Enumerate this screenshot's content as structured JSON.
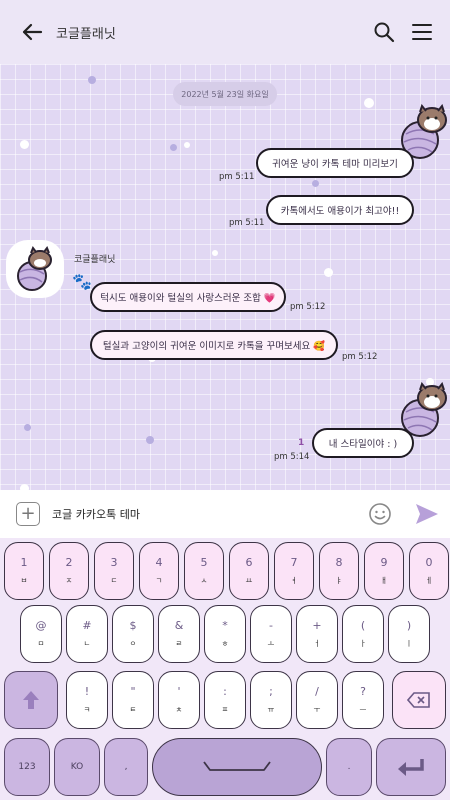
{
  "header": {
    "title": "코글플래닛"
  },
  "chat": {
    "date": "2022년 5월 23일 화요일",
    "sender_name": "코글플래닛",
    "messages": [
      {
        "text": "귀여운 냥이 카톡 테마 미리보기",
        "time": "pm 5:11",
        "side": "out"
      },
      {
        "text": "카톡에서도 애용이가 최고야!!",
        "time": "pm 5:11",
        "side": "out"
      },
      {
        "text": "턱시도 애용이와 털실의 사랑스러운 조합 💗",
        "time": "pm 5:12",
        "side": "in"
      },
      {
        "text": "털실과 고양이의 귀여운 이미지로 카톡을 꾸며보세요 🥰",
        "time": "pm 5:12",
        "side": "in"
      },
      {
        "text": "내 스타일이야 : )",
        "time": "pm 5:14",
        "side": "out",
        "unread": "1"
      }
    ]
  },
  "input": {
    "value": "코글 카카오톡 테마"
  },
  "keyboard": {
    "row1": [
      {
        "t": "1",
        "b": "ㅂ"
      },
      {
        "t": "2",
        "b": "ㅈ"
      },
      {
        "t": "3",
        "b": "ㄷ"
      },
      {
        "t": "4",
        "b": "ㄱ"
      },
      {
        "t": "5",
        "b": "ㅅ"
      },
      {
        "t": "6",
        "b": "ㅛ"
      },
      {
        "t": "7",
        "b": "ㅕ"
      },
      {
        "t": "8",
        "b": "ㅑ"
      },
      {
        "t": "9",
        "b": "ㅐ"
      },
      {
        "t": "0",
        "b": "ㅔ"
      }
    ],
    "row2": [
      {
        "t": "@",
        "b": "ㅁ"
      },
      {
        "t": "#",
        "b": "ㄴ"
      },
      {
        "t": "$",
        "b": "ㅇ"
      },
      {
        "t": "&",
        "b": "ㄹ"
      },
      {
        "t": "*",
        "b": "ㅎ"
      },
      {
        "t": "-",
        "b": "ㅗ"
      },
      {
        "t": "+",
        "b": "ㅓ"
      },
      {
        "t": "(",
        "b": "ㅏ"
      },
      {
        "t": ")",
        "b": "ㅣ"
      }
    ],
    "row3": [
      {
        "t": "!",
        "b": "ㅋ"
      },
      {
        "t": "\"",
        "b": "ㅌ"
      },
      {
        "t": "'",
        "b": "ㅊ"
      },
      {
        "t": ":",
        "b": "ㅍ"
      },
      {
        "t": ";",
        "b": "ㅠ"
      },
      {
        "t": "/",
        "b": "ㅜ"
      },
      {
        "t": "?",
        "b": "ㅡ"
      }
    ],
    "key_123": "123",
    "key_lang": "KO",
    "key_comma": ",",
    "key_period": "."
  },
  "colors": {
    "accent": "#b9a4d5",
    "bubble_border": "#1e1a22",
    "chat_bg": "#e1d8f3",
    "key_pink": "#fbe3f7"
  }
}
